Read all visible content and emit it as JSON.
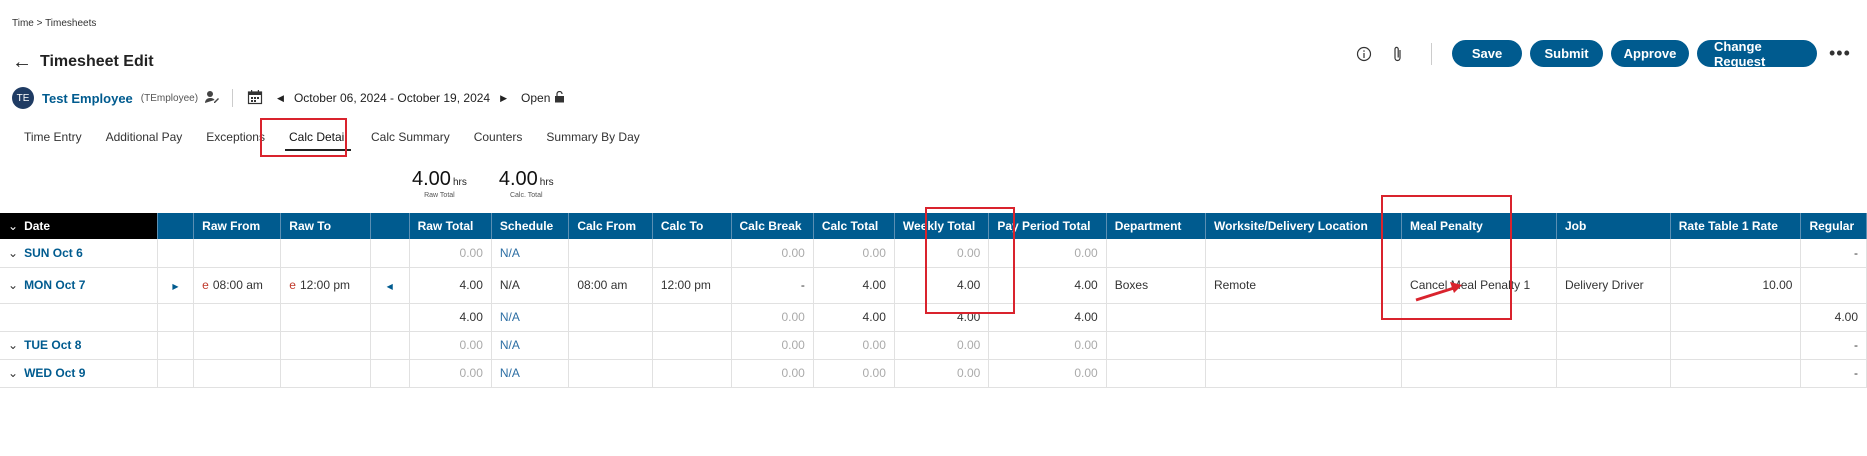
{
  "breadcrumb": "Time > Timesheets",
  "header": {
    "title": "Timesheet Edit",
    "actions": {
      "save": "Save",
      "submit": "Submit",
      "approve": "Approve",
      "change_request": "Change Request"
    }
  },
  "employee": {
    "initials": "TE",
    "name": "Test Employee",
    "id": "(TEmployee)",
    "period": "October 06, 2024 - October 19, 2024",
    "status": "Open"
  },
  "tabs": [
    "Time Entry",
    "Additional Pay",
    "Exceptions",
    "Calc Detail",
    "Calc Summary",
    "Counters",
    "Summary By Day"
  ],
  "active_tab": "Calc Detail",
  "summary": [
    {
      "value": "4.00",
      "unit": "hrs",
      "label": "Raw Total"
    },
    {
      "value": "4.00",
      "unit": "hrs",
      "label": "Calc. Total"
    }
  ],
  "table": {
    "columns": [
      "Date",
      "",
      "Raw From",
      "Raw To",
      "",
      "Raw Total",
      "Schedule",
      "Calc From",
      "Calc To",
      "Calc Break",
      "Calc Total",
      "Weekly Total",
      "Pay Period Total",
      "Department",
      "Worksite/Delivery Location",
      "Meal Penalty",
      "Job",
      "Rate Table 1 Rate",
      "Regular"
    ],
    "rows": [
      {
        "date": "SUN Oct 6",
        "raw_from": "",
        "raw_to": "",
        "raw_total": "0.00",
        "schedule": "N/A",
        "calc_from": "",
        "calc_to": "",
        "calc_break": "0.00",
        "calc_total": "0.00",
        "weekly_total": "0.00",
        "pay_period_total": "0.00",
        "department": "",
        "worksite": "",
        "meal_penalty": "",
        "job": "",
        "rate": "",
        "regular": "-"
      },
      {
        "date": "MON Oct 7",
        "e_from": "e",
        "raw_from": "08:00 am",
        "e_to": "e",
        "raw_to": "12:00 pm",
        "raw_total": "4.00",
        "schedule": "N/A",
        "calc_from": "08:00 am",
        "calc_to": "12:00 pm",
        "calc_break": "-",
        "calc_total": "4.00",
        "weekly_total": "4.00",
        "pay_period_total": "4.00",
        "department": "Boxes",
        "worksite": "Remote",
        "meal_penalty": "Cancel Meal Penalty 1",
        "job": "Delivery Driver",
        "rate": "10.00",
        "regular": ""
      },
      {
        "date": "",
        "raw_from": "",
        "raw_to": "",
        "raw_total": "4.00",
        "schedule": "N/A",
        "calc_from": "",
        "calc_to": "",
        "calc_break": "0.00",
        "calc_total": "4.00",
        "weekly_total": "4.00",
        "pay_period_total": "4.00",
        "department": "",
        "worksite": "",
        "meal_penalty": "",
        "job": "",
        "rate": "",
        "regular": "4.00"
      },
      {
        "date": "TUE Oct 8",
        "raw_from": "",
        "raw_to": "",
        "raw_total": "0.00",
        "schedule": "N/A",
        "calc_from": "",
        "calc_to": "",
        "calc_break": "0.00",
        "calc_total": "0.00",
        "weekly_total": "0.00",
        "pay_period_total": "0.00",
        "department": "",
        "worksite": "",
        "meal_penalty": "",
        "job": "",
        "rate": "",
        "regular": "-"
      },
      {
        "date": "WED Oct 9",
        "raw_from": "",
        "raw_to": "",
        "raw_total": "0.00",
        "schedule": "N/A",
        "calc_from": "",
        "calc_to": "",
        "calc_break": "0.00",
        "calc_total": "0.00",
        "weekly_total": "0.00",
        "pay_period_total": "0.00",
        "department": "",
        "worksite": "",
        "meal_penalty": "",
        "job": "",
        "rate": "",
        "regular": "-"
      }
    ]
  },
  "colors": {
    "primary": "#005b8f",
    "highlight": "#d9232d",
    "date_header": "#000000"
  }
}
